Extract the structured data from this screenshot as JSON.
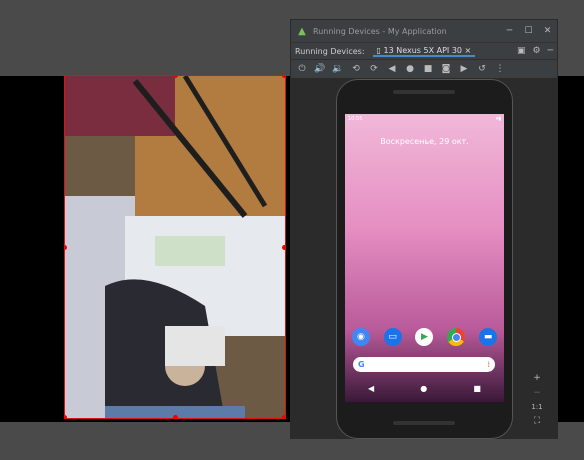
{
  "window": {
    "title": "Running Devices - My Application"
  },
  "device_bar": {
    "label": "Running Devices:",
    "tab_name": "13 Nexus 5X API 30"
  },
  "phone": {
    "status_time": "10:55",
    "date_text": "Воскресенье, 29 окт.",
    "apps": [
      "camera-icon",
      "messages-icon",
      "play-store-icon",
      "chrome-icon",
      "files-icon"
    ]
  },
  "side_controls": {
    "ratio_label": "1:1"
  },
  "colors": {
    "selection_border": "#dd1111",
    "accent": "#4a88c7"
  }
}
